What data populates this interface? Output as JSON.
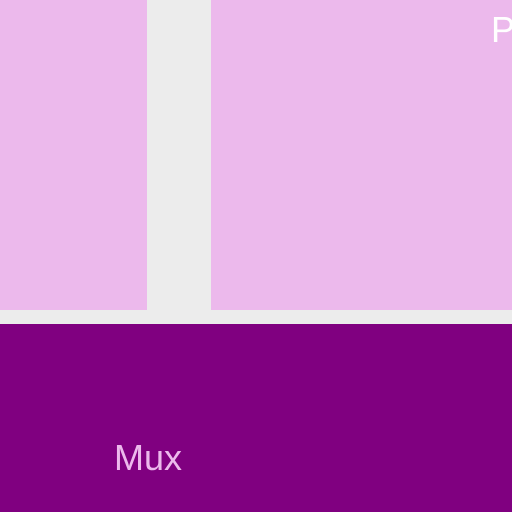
{
  "colors": {
    "background": "#ececec",
    "tile_light": "#ecb9ec",
    "tile_dark": "#800080",
    "text_light": "#ffffff",
    "text_on_dark": "#ecb9ec"
  },
  "tiles": {
    "left": {
      "label": ""
    },
    "right": {
      "label": "P"
    },
    "bottom": {
      "label": "Mux"
    }
  }
}
